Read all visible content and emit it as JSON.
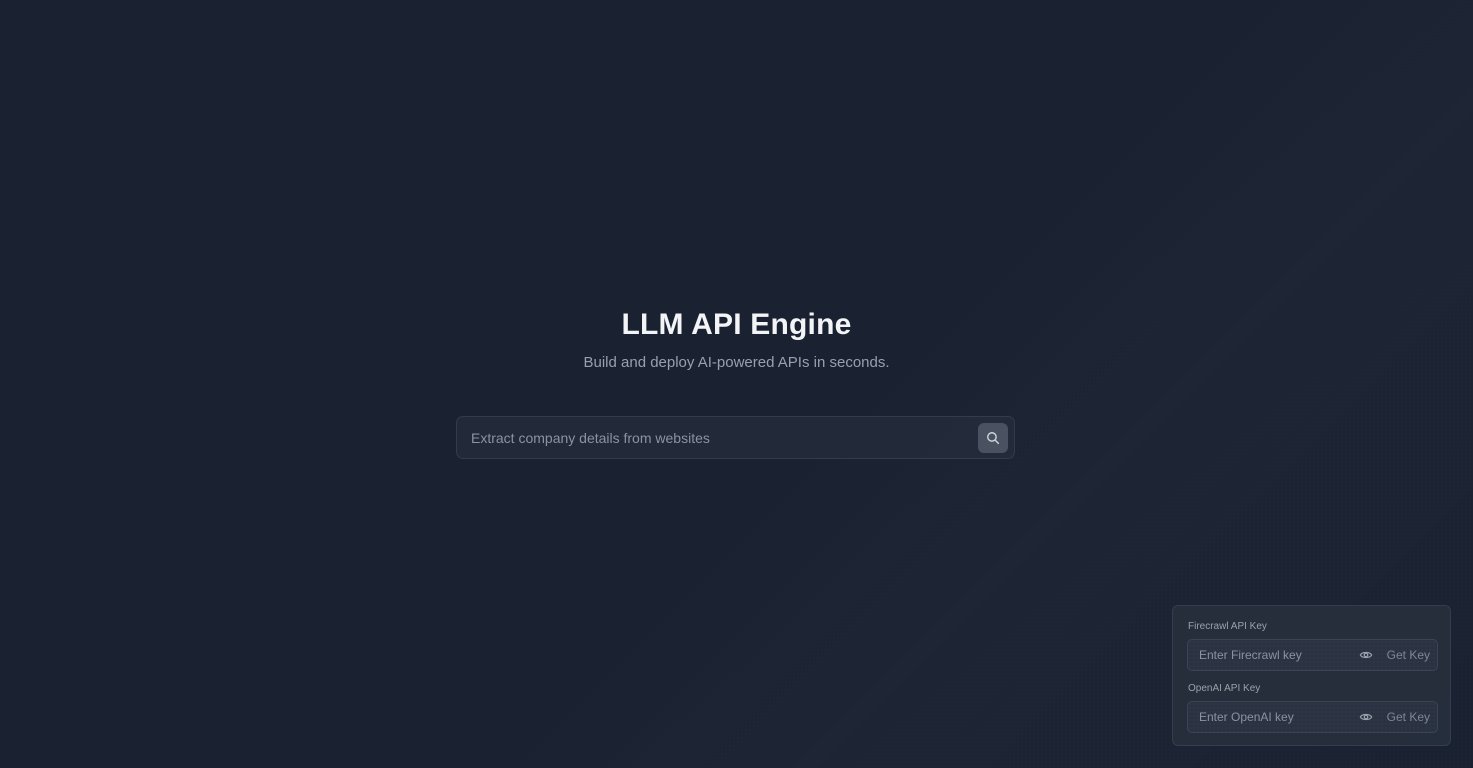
{
  "hero": {
    "title": "LLM API Engine",
    "subtitle": "Build and deploy AI-powered APIs in seconds."
  },
  "search": {
    "placeholder": "Extract company details from websites",
    "value": "",
    "button_icon": "search-icon"
  },
  "api_keys": {
    "firecrawl": {
      "label": "Firecrawl API Key",
      "placeholder": "Enter Firecrawl key",
      "value": "",
      "toggle_icon": "eye-icon",
      "link_label": "Get Key"
    },
    "openai": {
      "label": "OpenAI API Key",
      "placeholder": "Enter OpenAI key",
      "value": "",
      "toggle_icon": "eye-icon",
      "link_label": "Get Key"
    }
  },
  "colors": {
    "background": "#1a2232",
    "title": "#f3f4f6",
    "subtitle": "#98a0ad",
    "search_button": "#4a5261"
  }
}
